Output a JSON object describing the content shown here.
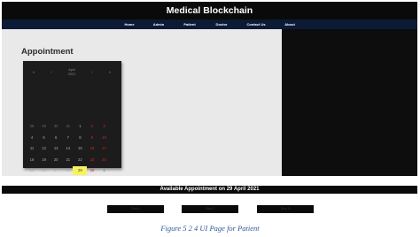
{
  "header": {
    "title": "Medical Blockchain"
  },
  "nav": {
    "items": [
      "Home",
      "Admin",
      "Patient",
      "Doctor",
      "Contact Us",
      "About"
    ]
  },
  "main": {
    "title": "Appointment"
  },
  "calendar": {
    "prev_year_icon": "«",
    "prev_month_icon": "‹",
    "next_month_icon": "›",
    "next_year_icon": "»",
    "month": "April",
    "year": "2021",
    "weeks": [
      [
        "28",
        "29",
        "30",
        "31",
        "1",
        "2",
        "3"
      ],
      [
        "4",
        "5",
        "6",
        "7",
        "8",
        "9",
        "10"
      ],
      [
        "11",
        "12",
        "13",
        "14",
        "15",
        "16",
        "17"
      ],
      [
        "18",
        "19",
        "20",
        "21",
        "22",
        "23",
        "24"
      ],
      [
        "25",
        "26",
        "27",
        "28",
        "29",
        "30",
        "1"
      ]
    ],
    "selected_day": "29",
    "colors": {
      "weekend": "#d02828",
      "selected": "#f6f35e"
    }
  },
  "availability": {
    "title": "Available Appointment on 29 April 2021",
    "slots": [
      "Slot 1",
      "Slot 2",
      "Slot 3"
    ]
  },
  "caption": "Figure 5 2 4 UI Page for Patient"
}
